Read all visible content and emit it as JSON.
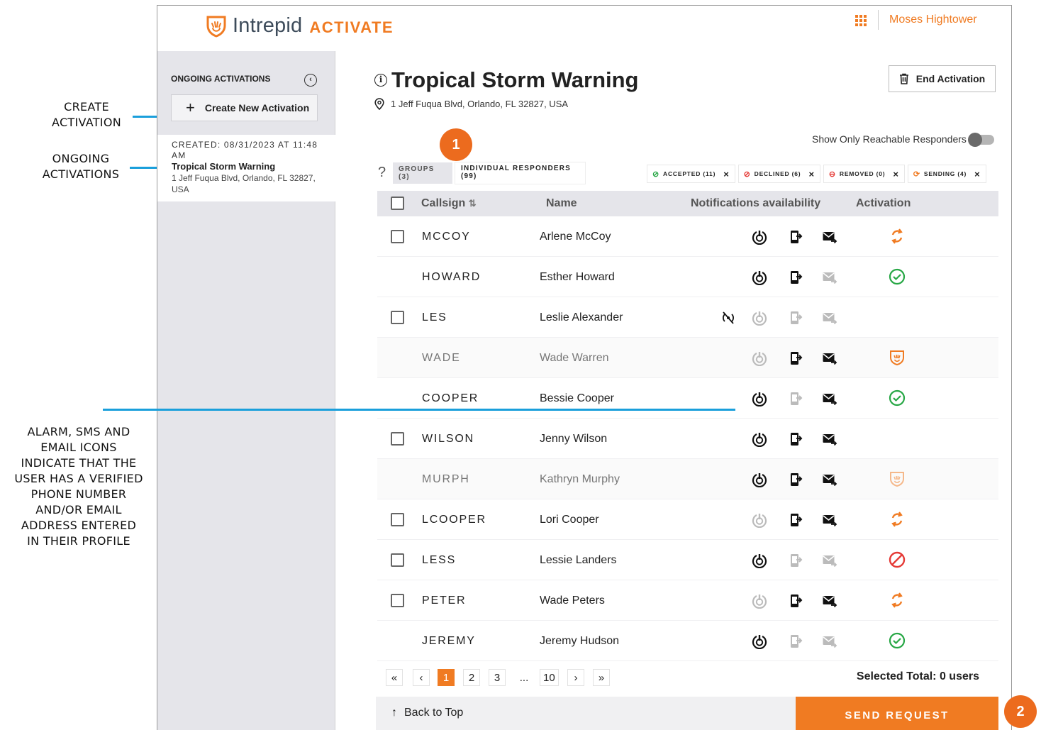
{
  "annotations": {
    "create": [
      "CREATE",
      "ACTIVATION"
    ],
    "ongoing": [
      "ONGOING",
      "ACTIVATIONS"
    ],
    "icons_note": [
      "ALARM, SMS AND",
      "EMAIL ICONS",
      "INDICATE THAT THE",
      "USER HAS A VERIFIED",
      "PHONE NUMBER",
      "AND/OR EMAIL",
      "ADDRESS ENTERED",
      "IN THEIR PROFILE"
    ],
    "badge1": "1",
    "badge2": "2"
  },
  "brand": {
    "name": "Intrepid",
    "accent": "ACTIVATE",
    "color": "#f07b22"
  },
  "header": {
    "user": "Moses Hightower",
    "apps_icon": "grid-icon"
  },
  "sidebar": {
    "title": "ONGOING ACTIVATIONS",
    "create_label": "Create New Activation",
    "card": {
      "created": "CREATED: 08/31/2023 AT 11:48 AM",
      "title": "Tropical Storm Warning",
      "address": "1 Jeff Fuqua Blvd, Orlando, FL 32827, USA"
    }
  },
  "activation": {
    "title": "Tropical Storm Warning",
    "address": "1 Jeff Fuqua Blvd, Orlando, FL 32827, USA",
    "end_label": "End Activation",
    "toggle_label": "Show Only Reachable Responders"
  },
  "tabs": {
    "groups": "GROUPS (3)",
    "individual": "INDIVIDUAL RESPONDERS (99)"
  },
  "filters": [
    {
      "label": "ACCEPTED (11)",
      "icon": "check-circle-icon",
      "color": "#27a745"
    },
    {
      "label": "DECLINED (6)",
      "icon": "ban-icon",
      "color": "#e53935"
    },
    {
      "label": "REMOVED (0)",
      "icon": "minus-circle-icon",
      "color": "#e53935"
    },
    {
      "label": "SENDING (4)",
      "icon": "sync-icon",
      "color": "#f07b22"
    }
  ],
  "table": {
    "headers": {
      "callsign": "Callsign",
      "name": "Name",
      "notif": "Notifications availability",
      "activation": "Activation"
    },
    "rows": [
      {
        "callsign": "MCCOY",
        "name": "Arlene McCoy",
        "checkbox": true,
        "dim": false,
        "alarm": true,
        "sms": true,
        "email": true,
        "nosignal": false,
        "status": "sending"
      },
      {
        "callsign": "HOWARD",
        "name": "Esther Howard",
        "checkbox": false,
        "dim": false,
        "alarm": true,
        "sms": true,
        "email": false,
        "nosignal": false,
        "status": "accepted"
      },
      {
        "callsign": "LES",
        "name": "Leslie Alexander",
        "checkbox": true,
        "dim": false,
        "alarm": false,
        "sms": false,
        "email": false,
        "nosignal": true,
        "status": ""
      },
      {
        "callsign": "WADE",
        "name": "Wade Warren",
        "checkbox": false,
        "dim": true,
        "alarm": false,
        "sms": true,
        "email": true,
        "nosignal": false,
        "status": "shield"
      },
      {
        "callsign": "COOPER",
        "name": "Bessie Cooper",
        "checkbox": false,
        "dim": false,
        "alarm": true,
        "sms": false,
        "email": true,
        "nosignal": false,
        "status": "accepted"
      },
      {
        "callsign": "WILSON",
        "name": "Jenny Wilson",
        "checkbox": true,
        "dim": false,
        "alarm": true,
        "sms": true,
        "email": true,
        "nosignal": false,
        "status": ""
      },
      {
        "callsign": "MURPH",
        "name": "Kathryn Murphy",
        "checkbox": false,
        "dim": true,
        "alarm": true,
        "sms": true,
        "email": true,
        "nosignal": false,
        "status": "shield-faded"
      },
      {
        "callsign": "LCOOPER",
        "name": "Lori Cooper",
        "checkbox": true,
        "dim": false,
        "alarm": false,
        "sms": true,
        "email": true,
        "nosignal": false,
        "status": "sending"
      },
      {
        "callsign": "LESS",
        "name": "Lessie Landers",
        "checkbox": true,
        "dim": false,
        "alarm": true,
        "sms": false,
        "email": false,
        "nosignal": false,
        "status": "declined"
      },
      {
        "callsign": "PETER",
        "name": "Wade Peters",
        "checkbox": true,
        "dim": false,
        "alarm": false,
        "sms": true,
        "email": true,
        "nosignal": false,
        "status": "sending"
      },
      {
        "callsign": "JEREMY",
        "name": "Jeremy Hudson",
        "checkbox": false,
        "dim": false,
        "alarm": true,
        "sms": false,
        "email": false,
        "nosignal": false,
        "status": "accepted"
      }
    ]
  },
  "pagination": {
    "first": "«",
    "prev": "‹",
    "pages": [
      "1",
      "2",
      "3"
    ],
    "ellipsis": "...",
    "last_page": "10",
    "next": "›",
    "last": "»",
    "current": "1"
  },
  "selection": {
    "total": "Selected Total: 0 users"
  },
  "footer": {
    "back_to_top": "Back to Top",
    "send": "SEND REQUEST"
  }
}
